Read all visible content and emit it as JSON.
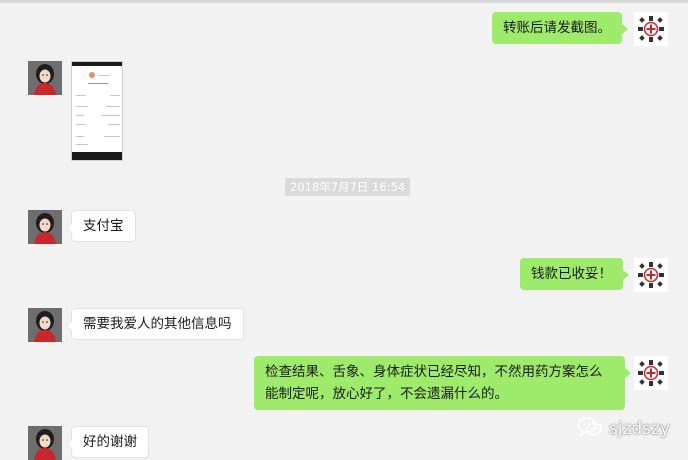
{
  "messages": {
    "m1": "转账后请发截图。",
    "m3": "支付宝",
    "m4": "钱款已收妥！",
    "m5": "需要我爱人的其他信息吗",
    "m6_line1": "检查结果、舌象、身体症状已经尽知，不然用药方案怎么",
    "m6_line2": "能制定呢，放心好了，不会遗漏什么的。",
    "m7": "好的谢谢"
  },
  "timestamp": "2018年7月7日 16:54",
  "watermark": {
    "text": "sjzdszy",
    "icon": "wechat-icon"
  },
  "colors": {
    "background": "#f2f2f2",
    "bubble_self": "#9eea6a",
    "bubble_other": "#ffffff",
    "timestamp_bg": "#dadada"
  },
  "icons": [
    "user-avatar",
    "clinic-logo-avatar",
    "wechat-icon"
  ]
}
